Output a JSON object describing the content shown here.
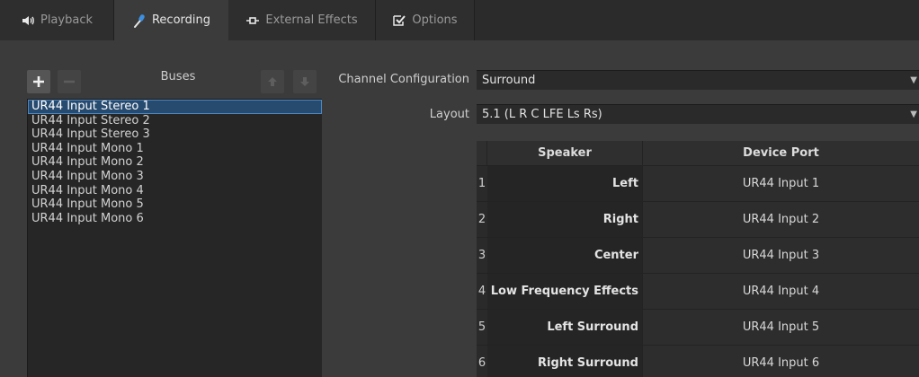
{
  "tabs": [
    {
      "label": "Playback",
      "icon": "speaker-icon",
      "active": false
    },
    {
      "label": "Recording",
      "icon": "microphone-icon",
      "active": true
    },
    {
      "label": "External Effects",
      "icon": "insert-icon",
      "active": false
    },
    {
      "label": "Options",
      "icon": "checkbox-icon",
      "active": false
    }
  ],
  "buses": {
    "label": "Buses",
    "items": [
      "UR44 Input Stereo 1",
      "UR44 Input Stereo 2",
      "UR44 Input Stereo 3",
      "UR44 Input Mono 1",
      "UR44 Input Mono 2",
      "UR44 Input Mono 3",
      "UR44 Input Mono 4",
      "UR44 Input Mono 5",
      "UR44 Input Mono 6"
    ],
    "selected_index": 0
  },
  "config": {
    "channel_configuration_label": "Channel Configuration",
    "channel_configuration_value": "Surround",
    "layout_label": "Layout",
    "layout_value": "5.1 (L R C LFE Ls Rs)"
  },
  "table": {
    "headers": [
      "Speaker",
      "Device Port"
    ],
    "rows": [
      {
        "num": "1",
        "speaker": "Left",
        "port": "UR44 Input 1"
      },
      {
        "num": "2",
        "speaker": "Right",
        "port": "UR44 Input 2"
      },
      {
        "num": "3",
        "speaker": "Center",
        "port": "UR44 Input 3"
      },
      {
        "num": "4",
        "speaker": "Low Frequency Effects",
        "port": "UR44 Input 4"
      },
      {
        "num": "5",
        "speaker": "Left Surround",
        "port": "UR44 Input 5"
      },
      {
        "num": "6",
        "speaker": "Right Surround",
        "port": "UR44 Input 6"
      }
    ]
  },
  "colors": {
    "background": "#3b3b3b",
    "selection": "#274a6f",
    "accent_blue": "#3d8fe0"
  }
}
